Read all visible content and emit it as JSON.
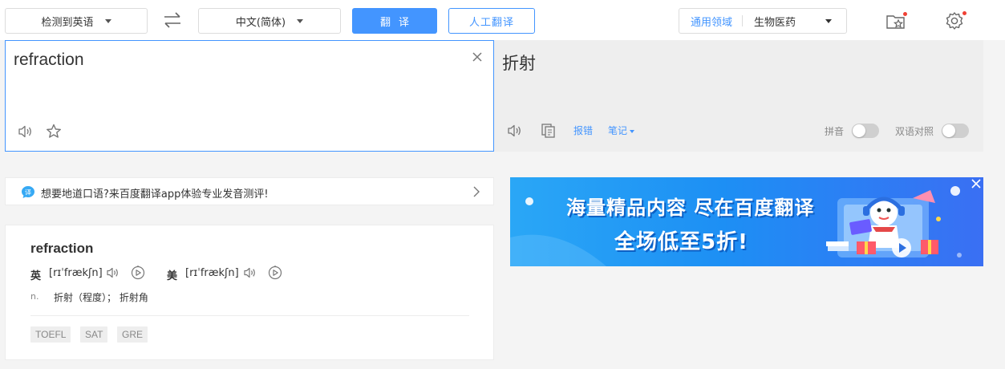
{
  "toolbar": {
    "source_lang": "检测到英语",
    "target_lang": "中文(简体)",
    "translate_label": "翻译",
    "human_translate_label": "人工翻译",
    "domain_label": "通用领域",
    "domain_value": "生物医药"
  },
  "input": {
    "text": "refraction"
  },
  "output": {
    "text": "折射",
    "report_label": "报错",
    "notes_label": "笔记",
    "pinyin_label": "拼音",
    "bilingual_label": "双语对照"
  },
  "promo": {
    "text": "想要地道口语?来百度翻译app体验专业发音测评!",
    "icon_char": "译"
  },
  "dictionary": {
    "word": "refraction",
    "uk_label": "英",
    "uk_phonetic": "[rɪˈfrækʃn]",
    "us_label": "美",
    "us_phonetic": "[rɪˈfrækʃn]",
    "pos": "n.",
    "meaning": "折射（程度）； 折射角",
    "tags": [
      "TOEFL",
      "SAT",
      "GRE"
    ]
  },
  "ad": {
    "line1": "海量精品内容 尽在百度翻译",
    "line2": "全场低至5折!"
  },
  "colors": {
    "accent": "#4395ff",
    "notification_dot": "#f04134"
  }
}
